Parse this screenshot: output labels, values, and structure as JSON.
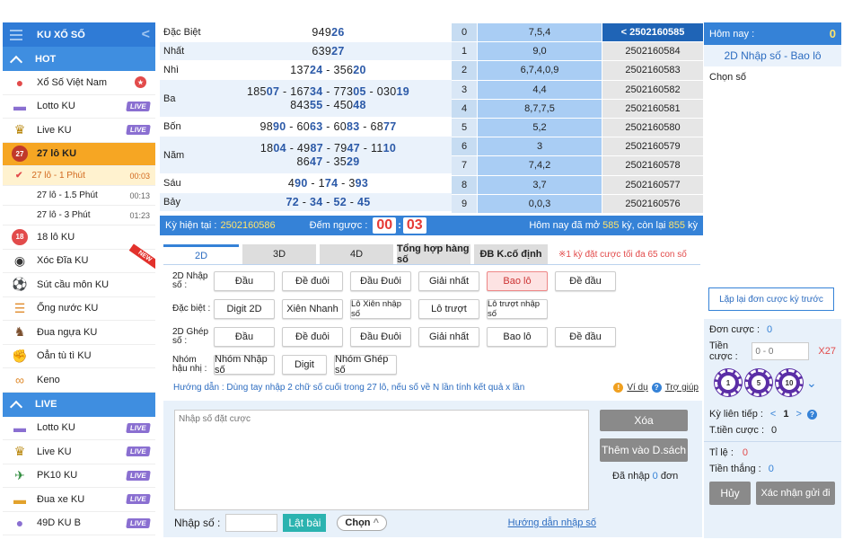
{
  "sidebar": {
    "title": "KU XỔ SỐ",
    "section_hot": "HOT",
    "section_live": "LIVE",
    "items": [
      {
        "label": "Xổ Số Việt Nam",
        "badge": "",
        "icon": "lottery-balls-icon"
      },
      {
        "label": "Lotto KU",
        "badge": "LIVE",
        "icon": "car-icon"
      },
      {
        "label": "Live KU",
        "badge": "LIVE",
        "icon": "dealer-icon"
      },
      {
        "label": "27 lô KU",
        "badge": "",
        "icon": "27-icon"
      },
      {
        "label": "18 lô KU",
        "badge": "",
        "icon": "18-icon"
      },
      {
        "label": "Xóc Đĩa KU",
        "badge": "NEW",
        "icon": "dice-icon"
      },
      {
        "label": "Sút cầu môn KU",
        "badge": "",
        "icon": "soccer-icon"
      },
      {
        "label": "Ống nước KU",
        "badge": "",
        "icon": "pipe-icon"
      },
      {
        "label": "Đua ngựa KU",
        "badge": "",
        "icon": "horse-icon"
      },
      {
        "label": "Oẳn tù tì KU",
        "badge": "",
        "icon": "hand-icon"
      },
      {
        "label": "Keno",
        "badge": "",
        "icon": "keno-icon"
      }
    ],
    "subitems": [
      {
        "label": "27 lô - 1 Phút",
        "time": "00:03"
      },
      {
        "label": "27 lô - 1.5 Phút",
        "time": "00:13"
      },
      {
        "label": "27 lô - 3 Phút",
        "time": "01:23"
      }
    ],
    "live_items": [
      {
        "label": "Lotto KU",
        "badge": "LIVE"
      },
      {
        "label": "Live KU",
        "badge": "LIVE"
      },
      {
        "label": "PK10 KU",
        "badge": "LIVE"
      },
      {
        "label": "Đua xe KU",
        "badge": "LIVE"
      },
      {
        "label": "49D KU B",
        "badge": "LIVE"
      }
    ]
  },
  "results": [
    {
      "name": "Đặc Biệt",
      "lines": [
        [
          [
            "949",
            ""
          ],
          [
            "26",
            "b"
          ]
        ]
      ]
    },
    {
      "name": "Nhất",
      "lines": [
        [
          [
            "639",
            ""
          ],
          [
            "27",
            "b"
          ]
        ]
      ]
    },
    {
      "name": "Nhì",
      "lines": [
        [
          [
            "137",
            ""
          ],
          [
            "24",
            "b"
          ],
          [
            " - 356",
            ""
          ],
          [
            "20",
            "b"
          ]
        ]
      ]
    },
    {
      "name": "Ba",
      "lines": [
        [
          [
            "185",
            ""
          ],
          [
            "07",
            "b"
          ],
          [
            " - 167",
            ""
          ],
          [
            "34",
            "b"
          ],
          [
            " - 773",
            ""
          ],
          [
            "05",
            "b"
          ],
          [
            " - 030",
            ""
          ],
          [
            "19",
            "b"
          ]
        ],
        [
          [
            "843",
            ""
          ],
          [
            "55",
            "b"
          ],
          [
            " - 450",
            ""
          ],
          [
            "48",
            "b"
          ]
        ]
      ]
    },
    {
      "name": "Bốn",
      "lines": [
        [
          [
            "98",
            ""
          ],
          [
            "90",
            "b"
          ],
          [
            " - 60",
            ""
          ],
          [
            "63",
            "b"
          ],
          [
            " - 60",
            ""
          ],
          [
            "83",
            "b"
          ],
          [
            " - 68",
            ""
          ],
          [
            "77",
            "b"
          ]
        ]
      ]
    },
    {
      "name": "Năm",
      "lines": [
        [
          [
            "18",
            ""
          ],
          [
            "04",
            "b"
          ],
          [
            " - 49",
            ""
          ],
          [
            "87",
            "b"
          ],
          [
            " - 79",
            ""
          ],
          [
            "47",
            "b"
          ],
          [
            " - 11",
            ""
          ],
          [
            "10",
            "b"
          ]
        ],
        [
          [
            "86",
            ""
          ],
          [
            "47",
            "b"
          ],
          [
            " - 35",
            ""
          ],
          [
            "29",
            "b"
          ]
        ]
      ]
    },
    {
      "name": "Sáu",
      "lines": [
        [
          [
            "4",
            ""
          ],
          [
            "90",
            "b"
          ],
          [
            " - 1",
            ""
          ],
          [
            "74",
            "b"
          ],
          [
            " - 3",
            ""
          ],
          [
            "93",
            "b"
          ]
        ]
      ]
    },
    {
      "name": "Bảy",
      "lines": [
        [
          [
            "72",
            "b"
          ],
          [
            " - ",
            ""
          ],
          [
            "34",
            "b"
          ],
          [
            " - ",
            ""
          ],
          [
            "52",
            "b"
          ],
          [
            " - ",
            ""
          ],
          [
            "45",
            "b"
          ]
        ]
      ]
    }
  ],
  "history": [
    {
      "i": "0",
      "v": "7,5,4",
      "k": "< 2502160585"
    },
    {
      "i": "1",
      "v": "9,0",
      "k": "2502160584"
    },
    {
      "i": "2",
      "v": "6,7,4,0,9",
      "k": "2502160583"
    },
    {
      "i": "3",
      "v": "4,4",
      "k": "2502160582"
    },
    {
      "i": "4",
      "v": "8,7,7,5",
      "k": "2502160581"
    },
    {
      "i": "5",
      "v": "5,2",
      "k": "2502160580"
    },
    {
      "i": "6",
      "v": "3",
      "k": "2502160579"
    },
    {
      "i": "7",
      "v": "7,4,2",
      "k": "2502160578"
    },
    {
      "i": "8",
      "v": "3,7",
      "k": "2502160577"
    },
    {
      "i": "9",
      "v": "0,0,3",
      "k": "2502160576"
    }
  ],
  "status": {
    "ky_label": "Kỳ hiện tại :",
    "ky": "2502160586",
    "dem": "Đếm ngược :",
    "mm": "00",
    "ss": "03",
    "today_a": "Hôm nay đã mở",
    "opened": "585",
    "today_b": "kỳ, còn lại",
    "remaining": "855",
    "today_c": "kỳ"
  },
  "tabs": [
    "2D",
    "3D",
    "4D",
    "Tổng hợp hàng số",
    "ĐB K.cố định"
  ],
  "tab_note": "※1 kỳ đặt cược tối đa 65 con số",
  "groups": [
    {
      "label": "2D Nhập số :",
      "buttons": [
        "Đầu",
        "Đề đuôi",
        "Đầu Đuôi",
        "Giải nhất",
        "Bao lô",
        "Đề đầu"
      ]
    },
    {
      "label": "Đặc biệt :",
      "buttons": [
        "Digit 2D",
        "Xiên Nhanh",
        "Lô Xiên nhập số",
        "Lô trượt",
        "Lô trượt nhập số"
      ]
    },
    {
      "label": "2D Ghép số :",
      "buttons": [
        "Đầu",
        "Đề đuôi",
        "Đầu Đuôi",
        "Giải nhất",
        "Bao lô",
        "Đề đầu"
      ]
    },
    {
      "label": "Nhóm hậu nhị :",
      "buttons": [
        "Nhóm Nhập số",
        "Digit",
        "Nhóm Ghép số"
      ]
    }
  ],
  "guide": {
    "text": "Hướng dẫn : Dùng tay nhập 2 chữ số cuối trong 27 lô, nếu số về N lần tính kết quả x lần",
    "example": "Ví dụ",
    "help": "Trợ giúp"
  },
  "entry": {
    "placeholder": "Nhập số đặt cược",
    "clear": "Xóa",
    "add": "Thêm vào D.sách",
    "entered_a": "Đã nhập",
    "entered_n": "0",
    "entered_b": "đơn",
    "input_label": "Nhập số :",
    "flip": "Lật bài",
    "choose": "Chọn",
    "guide_link": "Hướng dẫn nhập số"
  },
  "right": {
    "today": "Hôm nay :",
    "today_val": "0",
    "mode": "2D Nhập số - Bao lô",
    "chon_so": "Chọn số",
    "repeat": "Lặp lại đơn cược kỳ trước",
    "don_cuoc": "Đơn cược :",
    "don_val": "0",
    "tien_cuoc": "Tiền cược :",
    "tien_placeholder": "0 - 0",
    "mult": "X27",
    "chips": [
      "1",
      "5",
      "10"
    ],
    "ky_lien_tiep": "Kỳ liên tiếp :",
    "ky_val": "1",
    "t_tien": "T.tiền cược :",
    "t_tien_val": "0",
    "ti_le": "Tỉ lệ :",
    "ti_le_val": "0",
    "tien_thang": "Tiền thắng :",
    "tien_thang_val": "0",
    "huy": "Hủy",
    "confirm": "Xác nhận gửi đi"
  }
}
